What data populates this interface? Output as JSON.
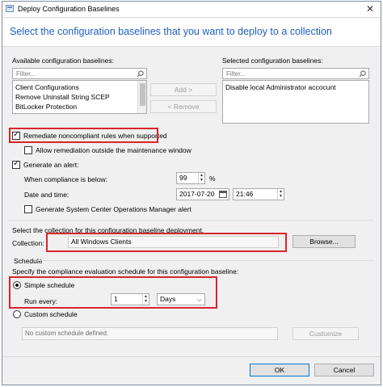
{
  "window": {
    "title": "Deploy Configuration Baselines",
    "close_glyph": "✕"
  },
  "heading": "Select the configuration baselines that you want to deploy to a collection",
  "available": {
    "label": "Available configuration baselines:",
    "filter_placeholder": "Filter...",
    "items": [
      "Client Configurations",
      "Remove Uninstall String SCEP",
      "BitLocker Protection"
    ]
  },
  "buttons": {
    "add": "Add >",
    "remove": "< Remove",
    "browse": "Browse...",
    "customize": "Customize",
    "ok": "OK",
    "cancel": "Cancel"
  },
  "selected": {
    "label": "Selected configuration baselines:",
    "filter_placeholder": "Filter...",
    "items": [
      "Disable local Administrator accocunt"
    ]
  },
  "options": {
    "remediate": {
      "label": "Remediate noncompliant rules when supported",
      "checked": true
    },
    "allow_outside": {
      "label": "Allow remediation outside the maintenance window",
      "checked": false
    },
    "generate_alert": {
      "label": "Generate an alert:",
      "checked": true
    },
    "compliance_label": "When compliance is below:",
    "compliance_value": "99",
    "compliance_unit": "%",
    "datetime_label": "Date and time:",
    "date_value": "2017-07-20",
    "time_value": "21:46",
    "scom_alert": {
      "label": "Generate System Center Operations Manager alert",
      "checked": false
    }
  },
  "collection": {
    "instruction": "Select the collection for this configuration baseline deployment.",
    "label": "Collection:",
    "value": "All Windows Clients"
  },
  "schedule": {
    "group_title": "Schedule",
    "instruction": "Specify the compliance evaluation schedule for this configuration baseline:",
    "simple_label": "Simple schedule",
    "simple_selected": true,
    "run_every_label": "Run every:",
    "run_every_value": "1",
    "unit_value": "Days",
    "custom_label": "Custom schedule",
    "custom_placeholder": "No custom schedule defined."
  },
  "colors": {
    "heading": "#1f5fbf",
    "highlight": "#d7262e",
    "ok_border": "#0078d7"
  },
  "icons": {
    "search": "search-icon",
    "calendar": "calendar-icon",
    "dropdown": "chevron-down-icon"
  }
}
